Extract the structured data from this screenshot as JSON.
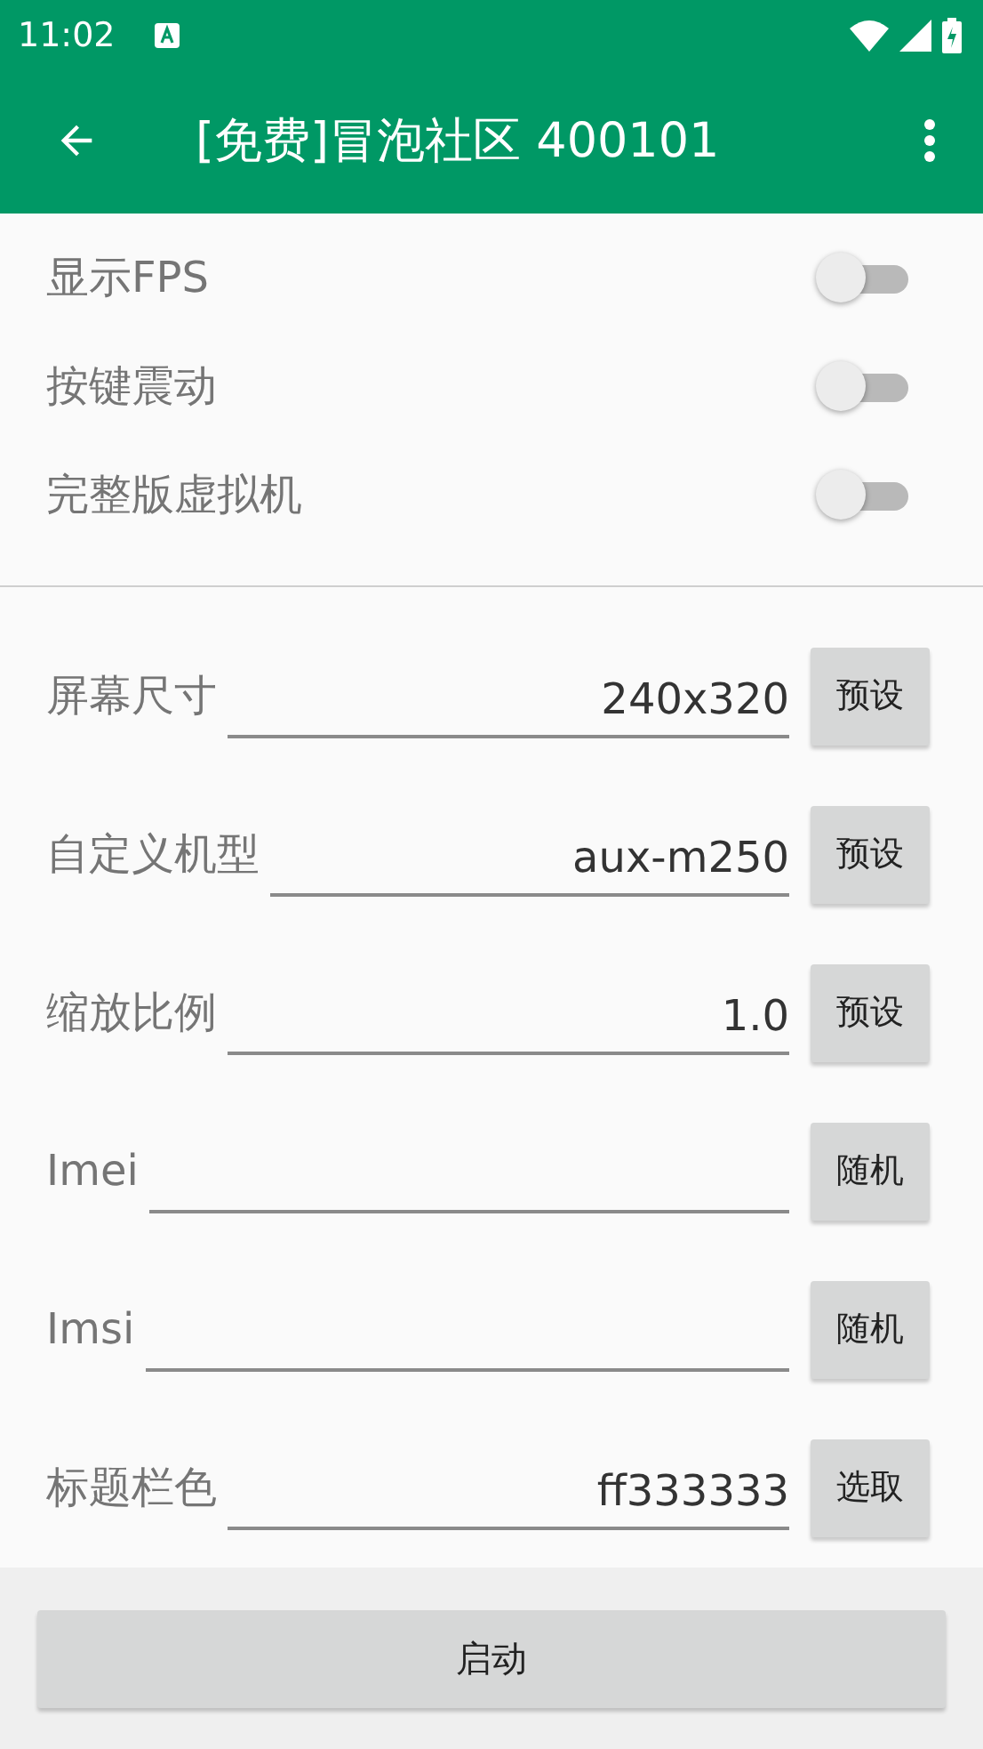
{
  "status_bar": {
    "time": "11:02"
  },
  "app_bar": {
    "title": "[免费]冒泡社区 400101"
  },
  "toggles": [
    {
      "label": "显示FPS",
      "on": false
    },
    {
      "label": "按键震动",
      "on": false
    },
    {
      "label": "完整版虚拟机",
      "on": false
    }
  ],
  "fields": [
    {
      "label": "屏幕尺寸",
      "value": "240x320",
      "button": "预设"
    },
    {
      "label": "自定义机型",
      "value": "aux-m250",
      "button": "预设"
    },
    {
      "label": "缩放比例",
      "value": "1.0",
      "button": "预设"
    },
    {
      "label": "Imei",
      "button": "随机"
    },
    {
      "label": "Imsi",
      "button": "随机"
    },
    {
      "label": "标题栏色",
      "value": "ff333333",
      "button": "选取"
    }
  ],
  "start_button": "启动"
}
